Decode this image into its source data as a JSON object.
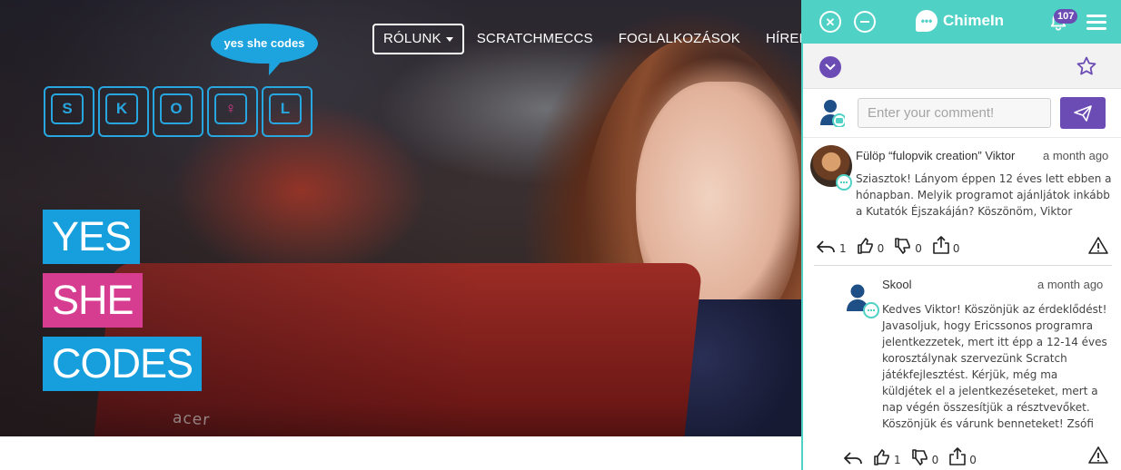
{
  "site": {
    "logo_bubble": "yes she codes",
    "logo_letters": [
      "S",
      "K",
      "O",
      "♀",
      "L"
    ],
    "nav": [
      {
        "label": "RÓLUNK",
        "active": true,
        "dropdown": true
      },
      {
        "label": "SCRATCHMECCS"
      },
      {
        "label": "FOGLALKOZÁSOK"
      },
      {
        "label": "HÍREK"
      }
    ],
    "headline": [
      "YES",
      "SHE",
      "CODES"
    ],
    "laptop_brand": "acer"
  },
  "panel": {
    "brand": "ChimeIn",
    "notifications_count": "107",
    "comment_input": {
      "placeholder": "Enter your comment!"
    },
    "comments": [
      {
        "author": "Fülöp “fulopvik creation” Viktor",
        "time": "a month ago",
        "body": "Sziasztok! Lányom éppen 12 éves lett ebben a hónapban. Melyik programot ajánljátok inkább a Kutatók Éjszakáján? Köszönöm, Viktor",
        "reply_count": "1",
        "like_count": "0",
        "dislike_count": "0",
        "share_count": "0"
      },
      {
        "author": "Skool",
        "time": "a month ago",
        "body": "Kedves Viktor! Köszönjük az érdeklődést! Javasoljuk, hogy Ericssonos programra jelentkezzetek, mert itt épp a 12-14 éves korosztálynak szervezünk Scratch játékfejlesztést. Kérjük, még ma küldjétek el a jelentkezéseteket, mert a nap végén összesítjük a résztvevőket. Köszönjük és várunk benneteket! Zsófi",
        "like_count": "1",
        "dislike_count": "0",
        "share_count": "0"
      }
    ]
  },
  "colors": {
    "panel_accent": "#4fd1c5",
    "panel_purple": "#6b4bb4",
    "headline_blue": "#169fdc",
    "headline_pink": "#d63c8f"
  }
}
